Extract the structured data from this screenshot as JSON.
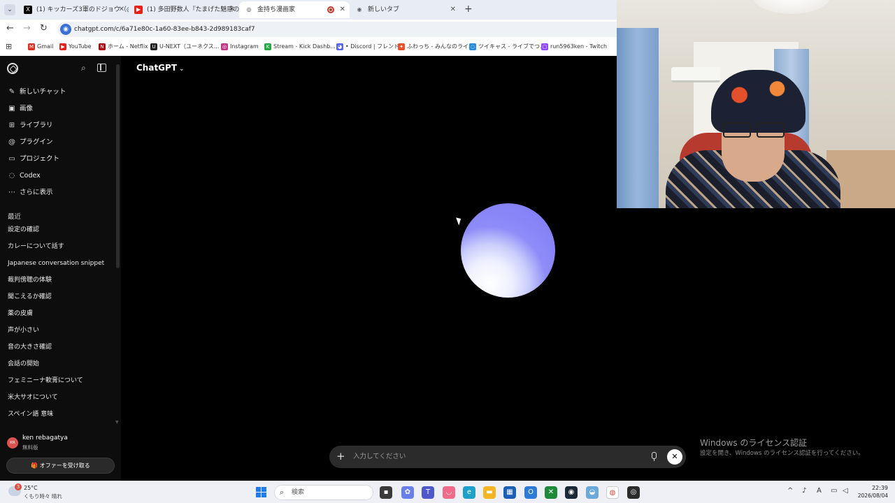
{
  "browser": {
    "tabs": [
      {
        "label": "(1) キッカーズ3軍のドジョウ（@run",
        "favicon": "X",
        "color": "#000000"
      },
      {
        "label": "(1) 多田野数人『たまげた魅惑の7",
        "favicon": "▶",
        "color": "#e62117"
      },
      {
        "label": "金持ち漫画家",
        "favicon": "◎",
        "color": "#444444"
      },
      {
        "label": "新しいタブ",
        "favicon": "◉",
        "color": "#5f6368"
      }
    ],
    "new_tab_label": "+",
    "url": "chatgpt.com/c/6a71e80c-1a60-83ee-b843-2d989183caf7",
    "bookmarks": [
      {
        "label": "Gmail",
        "color": "#d93025",
        "glyph": "M"
      },
      {
        "label": "YouTube",
        "color": "#e62117",
        "glyph": "▶"
      },
      {
        "label": "ホーム - Netflix",
        "color": "#b20710",
        "glyph": "N"
      },
      {
        "label": "U-NEXT（ユーネクス...",
        "color": "#222222",
        "glyph": "U"
      },
      {
        "label": "Instagram",
        "color": "#c13584",
        "glyph": "◎"
      },
      {
        "label": "Stream - Kick Dashb...",
        "color": "#28a745",
        "glyph": "K"
      },
      {
        "label": "• Discord | フレンド",
        "color": "#5865f2",
        "glyph": "◕"
      },
      {
        "label": "ふわっち - みんなのライ...",
        "color": "#e8502c",
        "glyph": "✦"
      },
      {
        "label": "ツイキャス - ライブでつ...",
        "color": "#2a8cd8",
        "glyph": "◌"
      },
      {
        "label": "run5963ken - Twitch",
        "color": "#9146ff",
        "glyph": "▢"
      }
    ]
  },
  "sidebar": {
    "nav": [
      {
        "label": "新しいチャット",
        "icon": "✎"
      },
      {
        "label": "画像",
        "icon": "▣"
      },
      {
        "label": "ライブラリ",
        "icon": "⊞"
      },
      {
        "label": "プラグイン",
        "icon": "@"
      },
      {
        "label": "プロジェクト",
        "icon": "▭"
      },
      {
        "label": "Codex",
        "icon": "◌"
      },
      {
        "label": "さらに表示",
        "icon": "⋯"
      }
    ],
    "recent_title": "最近",
    "recent": [
      "設定の確認",
      "カレーについて話す",
      "Japanese conversation snippet",
      "裁判傍聴の体験",
      "聞こえるか確認",
      "薬の皮膚",
      "声が小さい",
      "音の大きさ確認",
      "会話の開始",
      "フェミニーナ軟膏について",
      "米大サオについて",
      "スペイン語 意味"
    ],
    "user": {
      "initials": "KR",
      "name": "ken rebagatya",
      "plan": "無料版"
    },
    "offer_button": "🎁 オファーを受け取る"
  },
  "main": {
    "model_name": "ChatGPT",
    "composer_placeholder": "入力してください",
    "orb_colors": [
      "#7c79f5",
      "#ffffff"
    ]
  },
  "watermark": {
    "title": "Windows のライセンス認証",
    "subtitle": "設定を開き、Windows のライセンス認証を行ってください。"
  },
  "taskbar": {
    "weather_badge": "3",
    "temperature": "25°C",
    "weather_desc": "くもり時々 晴れ",
    "search_label": "検索",
    "time": "22:39",
    "date": "2026/08/04"
  }
}
